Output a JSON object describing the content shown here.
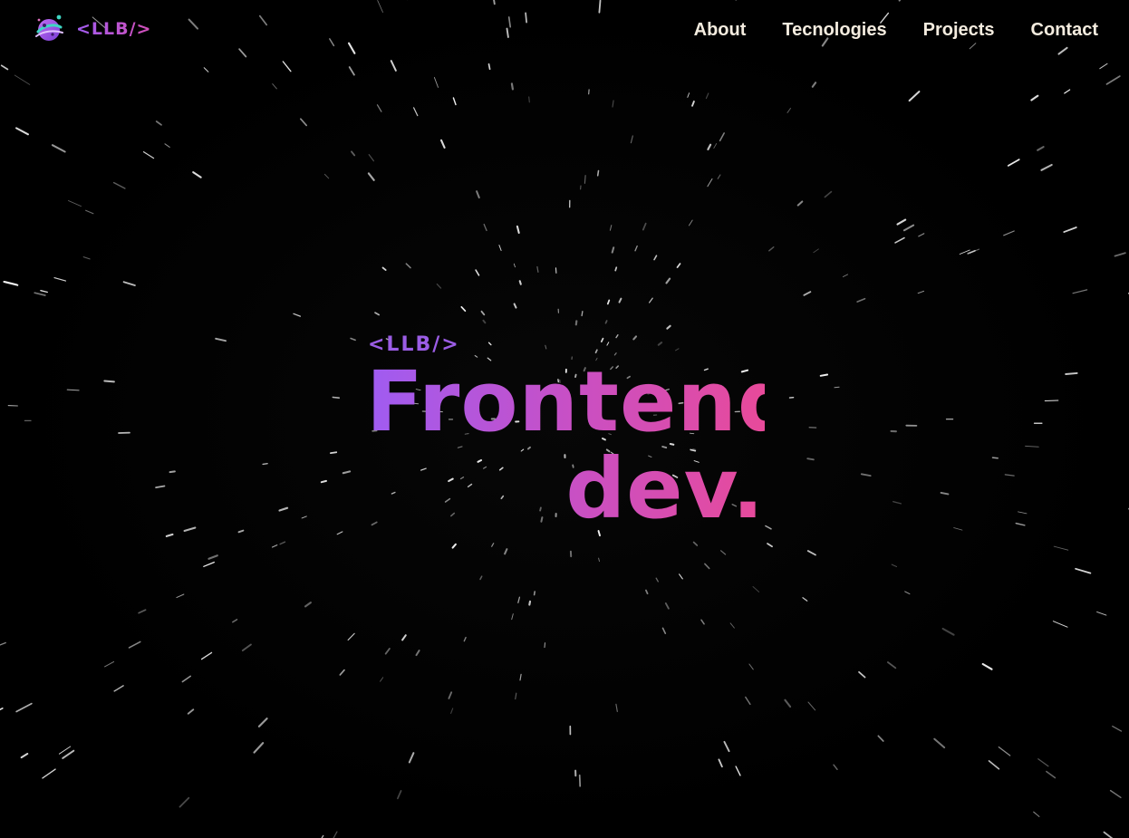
{
  "brand": {
    "logo_icon": "planet-icon",
    "text": "<LLB/>"
  },
  "nav": {
    "items": [
      {
        "label": "About"
      },
      {
        "label": "Tecnologies"
      },
      {
        "label": "Projects"
      },
      {
        "label": "Contact"
      }
    ]
  },
  "hero": {
    "tag": "<LLB/>",
    "title_line1": "Frontend",
    "title_line2": "dev."
  },
  "colors": {
    "background": "#000000",
    "nav_text": "#f4ecdf",
    "accent_purple": "#9b5de5",
    "accent_pink": "#e84a9a"
  }
}
